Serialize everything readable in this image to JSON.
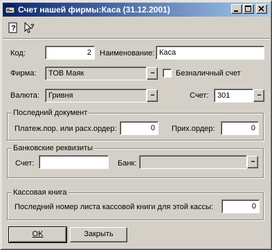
{
  "window": {
    "title": "Счет нашей фирмы:Каса (31.12.2001)"
  },
  "toolbar": {
    "help_icon": "help-icon",
    "context_help_icon": "context-help-icon"
  },
  "form": {
    "code_label": "Код:",
    "code_value": "2",
    "name_label": "Наименование:",
    "name_value": "Каса",
    "firm_label": "Фирма:",
    "firm_value": "ТОВ Маяк",
    "cashless_label": "Безналичный счет",
    "cashless_checked": false,
    "currency_label": "Валюта:",
    "currency_value": "Гривня",
    "account_label": "Счет:",
    "account_value": "301",
    "ellipsis": "..."
  },
  "last_document": {
    "title": "Последний документ",
    "payment_label": "Платеж.пор. или расх.ордер:",
    "payment_value": "0",
    "receipt_label": "Прих.ордер:",
    "receipt_value": "0"
  },
  "bank_details": {
    "title": "Банковские реквизиты",
    "account_label": "Счет:",
    "account_value": "",
    "bank_label": "Банк:",
    "bank_value": ""
  },
  "cash_book": {
    "title": "Кассовая книга",
    "last_sheet_label": "Последний номер листа кассовой книги для этой кассы:",
    "last_sheet_value": "0"
  },
  "buttons": {
    "ok_label": "OK",
    "close_label": "Закрыть"
  }
}
